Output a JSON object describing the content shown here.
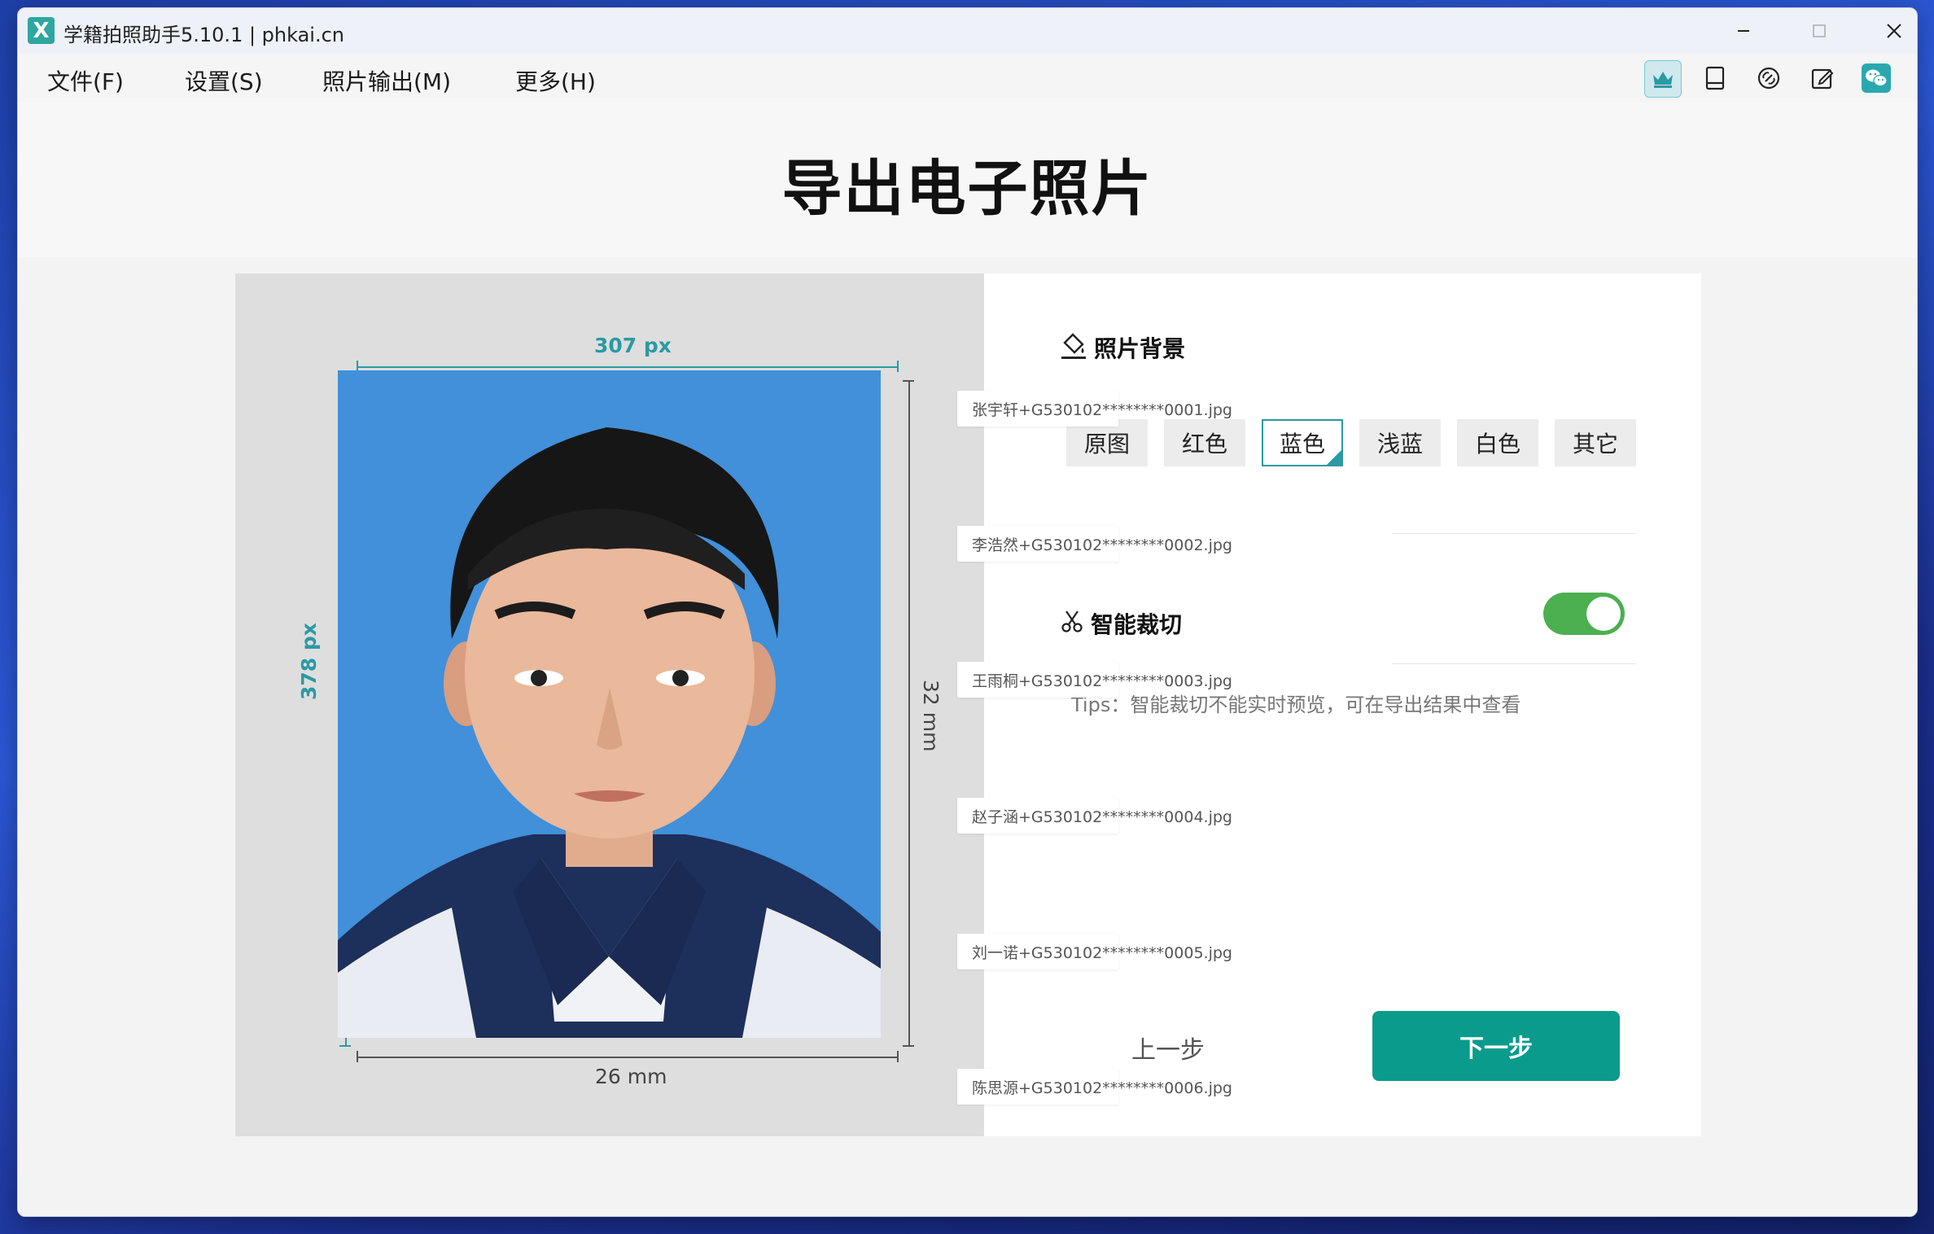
{
  "window": {
    "title": "学籍拍照助手5.10.1 | phkai.cn",
    "logo_letter": "X",
    "controls": {
      "minimize": "minimize-icon",
      "maximize": "maximize-icon",
      "close": "close-icon"
    }
  },
  "menu": {
    "file": "文件(F)",
    "settings": "设置(S)",
    "photo_output": "照片输出(M)",
    "more": "更多(H)"
  },
  "toolbar_icons": [
    "crown-icon",
    "tablet-icon",
    "link-icon",
    "edit-icon",
    "wechat-icon"
  ],
  "page": {
    "title": "导出电子照片"
  },
  "ruler_labels": {
    "width_px": "307 px",
    "height_px": "378 px",
    "width_mm": "26 mm",
    "height_mm": "32 mm"
  },
  "background_section": {
    "title": "照片背景",
    "options": [
      {
        "label": "原图",
        "selected": false
      },
      {
        "label": "红色",
        "selected": false
      },
      {
        "label": "蓝色",
        "selected": true
      },
      {
        "label": "浅蓝",
        "selected": false
      },
      {
        "label": "白色",
        "selected": false
      },
      {
        "label": "其它",
        "selected": false
      }
    ]
  },
  "smart_crop": {
    "title": "智能裁切",
    "enabled": true,
    "tips": "Tips：智能裁切不能实时预览，可在导出结果中查看"
  },
  "buttons": {
    "prev": "上一步",
    "next": "下一步"
  },
  "file_tags": [
    "张宇轩+G530102********0001.jpg",
    "李浩然+G530102********0002.jpg",
    "王雨桐+G530102********0003.jpg",
    "赵子涵+G530102********0004.jpg",
    "刘一诺+G530102********0005.jpg",
    "陈思源+G530102********0006.jpg"
  ],
  "colors": {
    "accent": "#2a9aa3",
    "photo_background": "#4190d9",
    "next_button": "#0b9b8c",
    "toggle_on": "#4caf50"
  }
}
